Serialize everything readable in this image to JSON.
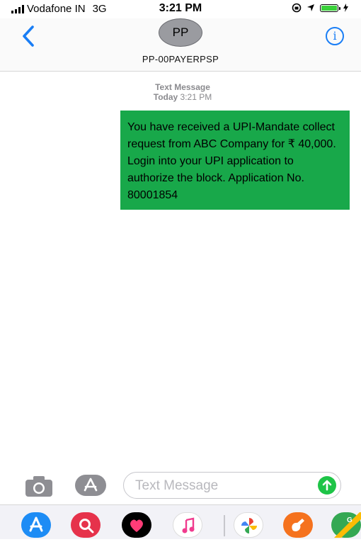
{
  "status_bar": {
    "carrier": "Vodafone IN",
    "network": "3G",
    "time": "3:21 PM"
  },
  "header": {
    "avatar_initials": "PP",
    "contact_name": "PP-00PAYERPSP",
    "info_glyph": "i"
  },
  "thread": {
    "meta_label": "Text Message",
    "meta_day": "Today",
    "meta_time": "3:21 PM",
    "message": "You have received a UPI-Mandate collect request from ABC Company for ₹ 40,000. Login into your UPI application to authorize the block. Application No. 80001854",
    "bubble_color": "#18a84a"
  },
  "composer": {
    "placeholder": "Text Message"
  },
  "icons": {
    "back": "chevron-left-icon",
    "info": "info-icon",
    "camera": "camera-icon",
    "apps": "app-store-icon",
    "send": "send-arrow-icon"
  },
  "dock": [
    "app-store-app",
    "search-web-app",
    "digital-touch-app",
    "music-app",
    "photos-app",
    "garageband-app",
    "maps-app"
  ],
  "colors": {
    "ios_blue": "#1a7ef5",
    "send_green": "#1ec447",
    "avatar_gray": "#9a9ba0"
  }
}
